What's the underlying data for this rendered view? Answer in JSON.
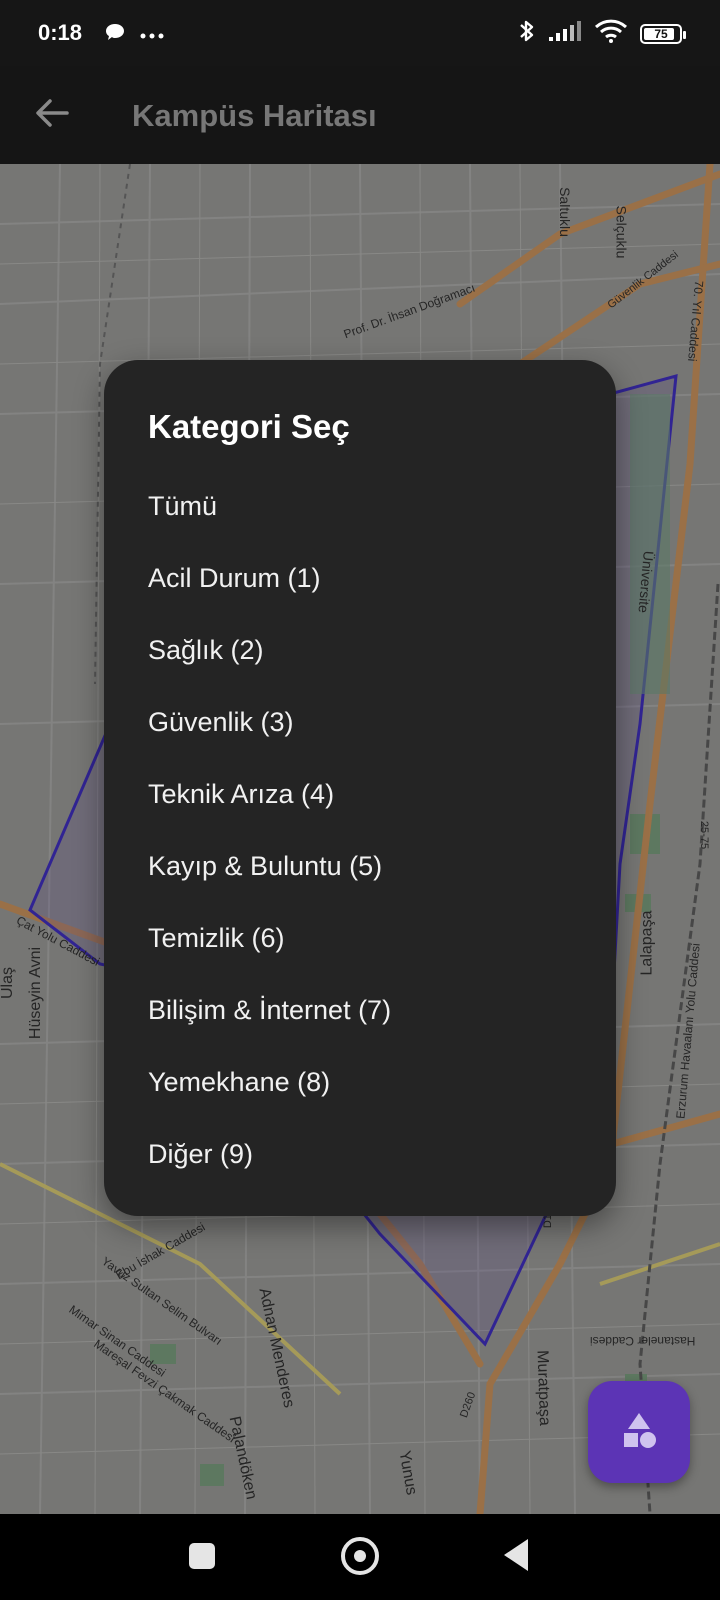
{
  "status_bar": {
    "time": "0:18",
    "left_icons": [
      "chat-bubble-icon",
      "more-dots-icon"
    ],
    "right_icons": [
      "bluetooth-icon",
      "signal-icon",
      "wifi-icon",
      "battery-icon"
    ],
    "battery_level": "75"
  },
  "app_bar": {
    "title": "Kampüs Haritası",
    "back_icon": "arrow-left-icon"
  },
  "map": {
    "labels": [
      "Saltuklu",
      "Selçuklu",
      "Prof. Dr. İhsan Doğramacı",
      "Güvenlik Caddesi",
      "70. Yıl Caddesi",
      "Üniversite",
      "Erzurum Havaalanı Yolu Caddesi",
      "Lalapaşa",
      "Hüseyin Avni",
      "Ulaş",
      "Çat Yolu Caddesi",
      "Ebu İshak Caddesi",
      "Yavuz Sultan Selim Bulvarı",
      "Mimar Sinan Caddesi",
      "Mareşal Fevzi Çakmak Caddesi",
      "Adnan Menderes",
      "Palandöken",
      "Muratpaşa",
      "Hastaneler Caddesi",
      "Yunus",
      "D260",
      "D100",
      "25-75"
    ]
  },
  "dialog": {
    "title": "Kategori Seç",
    "options": [
      "Tümü",
      "Acil Durum (1)",
      "Sağlık (2)",
      "Güvenlik (3)",
      "Teknik Arıza (4)",
      "Kayıp & Buluntu (5)",
      "Temizlik (6)",
      "Bilişim & İnternet (7)",
      "Yemekhane (8)",
      "Diğer (9)"
    ]
  },
  "fab": {
    "icon": "shapes-icon",
    "color": "#5c34b5"
  },
  "nav_bar": {
    "icons": [
      "recents-square-icon",
      "home-circle-icon",
      "back-triangle-icon"
    ]
  },
  "colors": {
    "dialog_bg": "#242424",
    "app_bar_bg": "#151515",
    "campus_outline": "#3b2bb0",
    "road_orange": "#c99056"
  }
}
